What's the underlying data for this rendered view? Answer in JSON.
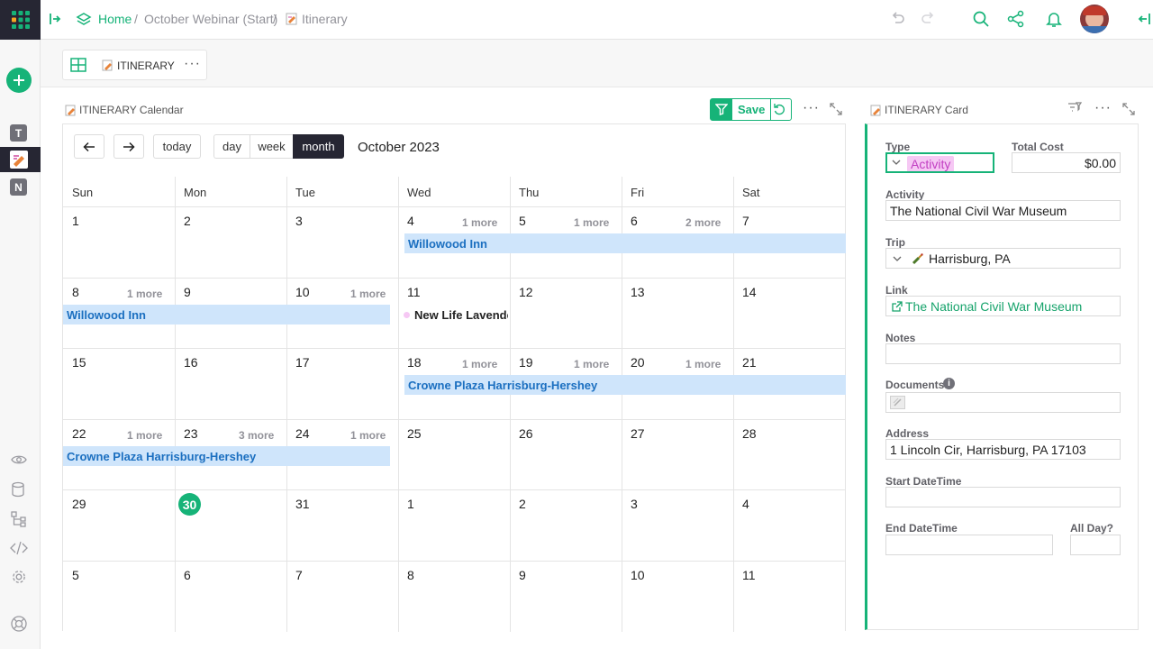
{
  "breadcrumb": {
    "home": "Home",
    "sep1": "/",
    "doc": "October Webinar (Start)",
    "sep2": "/",
    "page": "Itinerary"
  },
  "rail": {
    "items": [
      "T",
      "N"
    ]
  },
  "view_tab": {
    "label": "ITINERARY",
    "menu": "···"
  },
  "calendar": {
    "title": "ITINERARY Calendar",
    "save_label": "Save",
    "today_label": "today",
    "views": [
      "day",
      "week",
      "month"
    ],
    "active_view": "month",
    "month_title": "October 2023",
    "weekdays": [
      "Sun",
      "Mon",
      "Tue",
      "Wed",
      "Thu",
      "Fri",
      "Sat"
    ],
    "weeks": [
      [
        "1",
        "2",
        "3",
        "4",
        "5",
        "6",
        "7"
      ],
      [
        "8",
        "9",
        "10",
        "11",
        "12",
        "13",
        "14"
      ],
      [
        "15",
        "16",
        "17",
        "18",
        "19",
        "20",
        "21"
      ],
      [
        "22",
        "23",
        "24",
        "25",
        "26",
        "27",
        "28"
      ],
      [
        "29",
        "30",
        "31",
        "1",
        "2",
        "3",
        "4"
      ],
      [
        "5",
        "6",
        "7",
        "8",
        "9",
        "10",
        "11"
      ]
    ],
    "today_day": "30",
    "more_labels": [
      {
        "week": 0,
        "day": 3,
        "text": "1 more"
      },
      {
        "week": 0,
        "day": 4,
        "text": "1 more"
      },
      {
        "week": 0,
        "day": 5,
        "text": "2 more"
      },
      {
        "week": 1,
        "day": 0,
        "text": "1 more"
      },
      {
        "week": 1,
        "day": 2,
        "text": "1 more"
      },
      {
        "week": 2,
        "day": 3,
        "text": "1 more"
      },
      {
        "week": 2,
        "day": 4,
        "text": "1 more"
      },
      {
        "week": 2,
        "day": 5,
        "text": "1 more"
      },
      {
        "week": 3,
        "day": 0,
        "text": "1 more"
      },
      {
        "week": 3,
        "day": 1,
        "text": "3 more"
      },
      {
        "week": 3,
        "day": 2,
        "text": "1 more"
      }
    ],
    "events": [
      {
        "week": 0,
        "start": 3,
        "end": 6,
        "title": "Willowood Inn",
        "kind": "bar"
      },
      {
        "week": 1,
        "start": 0,
        "end": 2,
        "title": "Willowood Inn",
        "kind": "bar"
      },
      {
        "week": 1,
        "start": 3,
        "end": 3,
        "title": "New Life Lavende",
        "kind": "dot"
      },
      {
        "week": 2,
        "start": 3,
        "end": 6,
        "title": "Crowne Plaza Harrisburg-Hershey",
        "kind": "bar"
      },
      {
        "week": 3,
        "start": 0,
        "end": 2,
        "title": "Crowne Plaza Harrisburg-Hershey",
        "kind": "bar"
      }
    ]
  },
  "card": {
    "title": "ITINERARY Card",
    "fields": {
      "type_label": "Type",
      "type_value": "Activity",
      "total_cost_label": "Total Cost",
      "total_cost_value": "$0.00",
      "activity_label": "Activity",
      "activity_value": "The National Civil War Museum",
      "trip_label": "Trip",
      "trip_value": "Harrisburg, PA",
      "link_label": "Link",
      "link_value": "The National Civil War Museum",
      "notes_label": "Notes",
      "notes_value": "",
      "documents_label": "Documents",
      "address_label": "Address",
      "address_value": "1 Lincoln Cir, Harrisburg, PA 17103",
      "start_label": "Start DateTime",
      "start_value": "",
      "end_label": "End DateTime",
      "end_value": "",
      "allday_label": "All Day?"
    }
  },
  "colors": {
    "accent": "#16b378",
    "event_bg": "#cfe5fb",
    "event_text": "#1b6fc0",
    "today_circle": "#16b378",
    "type_chip_bg": "#f6c8f4",
    "type_chip_text": "#c13ec2",
    "link_text": "#16a36b",
    "dark": "#262633"
  },
  "icons": [
    "grid-logo-icon",
    "sidebar-toggle-icon",
    "layers-icon",
    "page-icon",
    "undo-icon",
    "redo-icon",
    "search-icon",
    "share-icon",
    "bell-icon",
    "avatar",
    "add-icon",
    "eye-icon",
    "database-icon",
    "structure-icon",
    "code-icon",
    "settings-icon",
    "help-icon",
    "table-view-icon",
    "filter-icon",
    "revert-icon",
    "expand-icon",
    "chevron-left-icon",
    "chevron-right-icon",
    "info-icon",
    "paperclip-icon",
    "external-link-icon",
    "chevron-down-icon",
    "bottle-icon"
  ]
}
